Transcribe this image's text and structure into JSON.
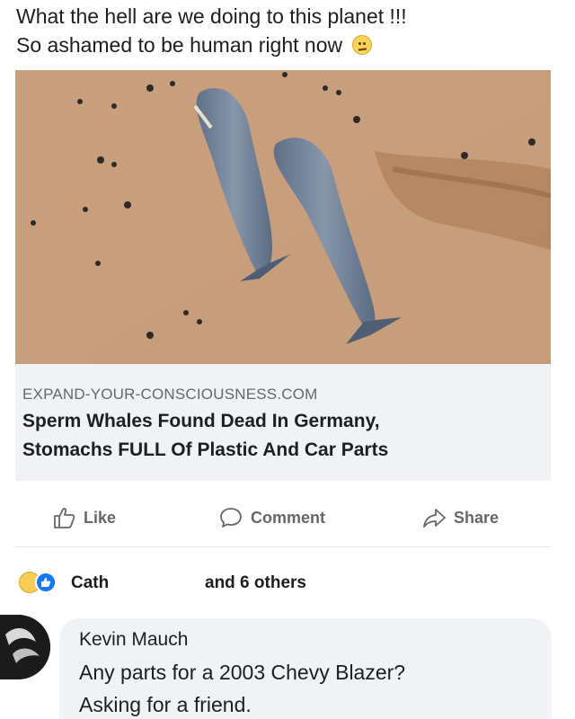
{
  "post": {
    "text_line1": "What the hell are we doing to this planet !!!",
    "text_line2": "So ashamed to be human right now",
    "emoji": "confused-face-icon"
  },
  "link_preview": {
    "domain": "EXPAND-YOUR-CONSCIOUSNESS.COM",
    "title_line1": "Sperm Whales Found Dead In Germany,",
    "title_line2": "Stomachs FULL Of Plastic And Car Parts",
    "image_subject": "beached-whales-photo"
  },
  "actions": {
    "like_label": "Like",
    "comment_label": "Comment",
    "share_label": "Share"
  },
  "reactions": {
    "name": "Cath",
    "others": "and 6 others"
  },
  "comment": {
    "author": "Kevin Mauch",
    "text_line1": "Any parts for a 2003 Chevy Blazer?",
    "text_line2": "Asking for a friend."
  },
  "colors": {
    "accent": "#1877f2",
    "secondary_text": "#65676b",
    "bubble_bg": "#f0f2f5",
    "sand": "#c79e7c"
  }
}
